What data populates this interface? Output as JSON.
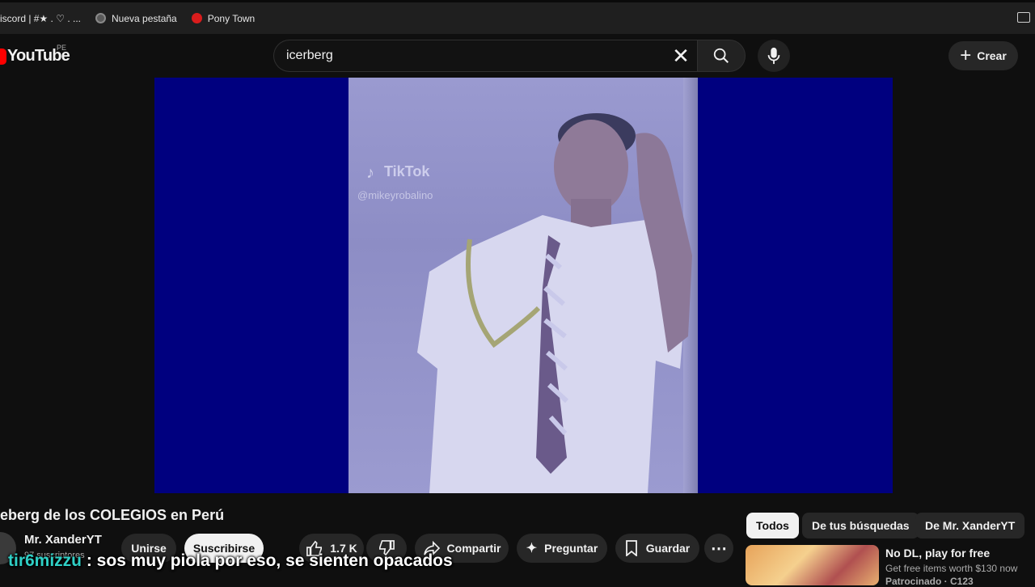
{
  "bookmarks": [
    {
      "label": "iscord | #★ . ♡ . ...",
      "icon": "discord-icon",
      "color": "#5865f2"
    },
    {
      "label": "Nueva pestaña",
      "icon": "globe-icon",
      "color": "#8a8a8a"
    },
    {
      "label": "Pony Town",
      "icon": "apple-icon",
      "color": "#d91c1c"
    }
  ],
  "header": {
    "logo_text": "YouTube",
    "region": "PE",
    "search_value": "icerberg",
    "create_label": "Crear"
  },
  "video": {
    "watermark_brand": "TikTok",
    "watermark_handle": "@mikeyrobalino",
    "title": "eberg de los COLEGIOS en Perú",
    "channel": "Mr. XanderYT",
    "subscribers": "97 suscriptores",
    "join_label": "Unirse",
    "subscribe_label": "Suscribirse",
    "likes": "1.7 K",
    "share_label": "Compartir",
    "ask_label": "Preguntar",
    "save_label": "Guardar"
  },
  "sidebar": {
    "chips": [
      "Todos",
      "De tus búsquedas",
      "De Mr. XanderYT"
    ],
    "ad": {
      "title": "No DL, play for free",
      "subtitle": "Get free items worth $130 now",
      "sponsor": "Patrocinado · C123"
    }
  },
  "overlay_caption": {
    "user": "tir6mizzu",
    "text": ": sos muy piola por eso, se sienten opacados"
  },
  "colors": {
    "brand_red": "#ff0000",
    "player_bg": "#00007f",
    "caption_user": "#2fd0c6"
  }
}
